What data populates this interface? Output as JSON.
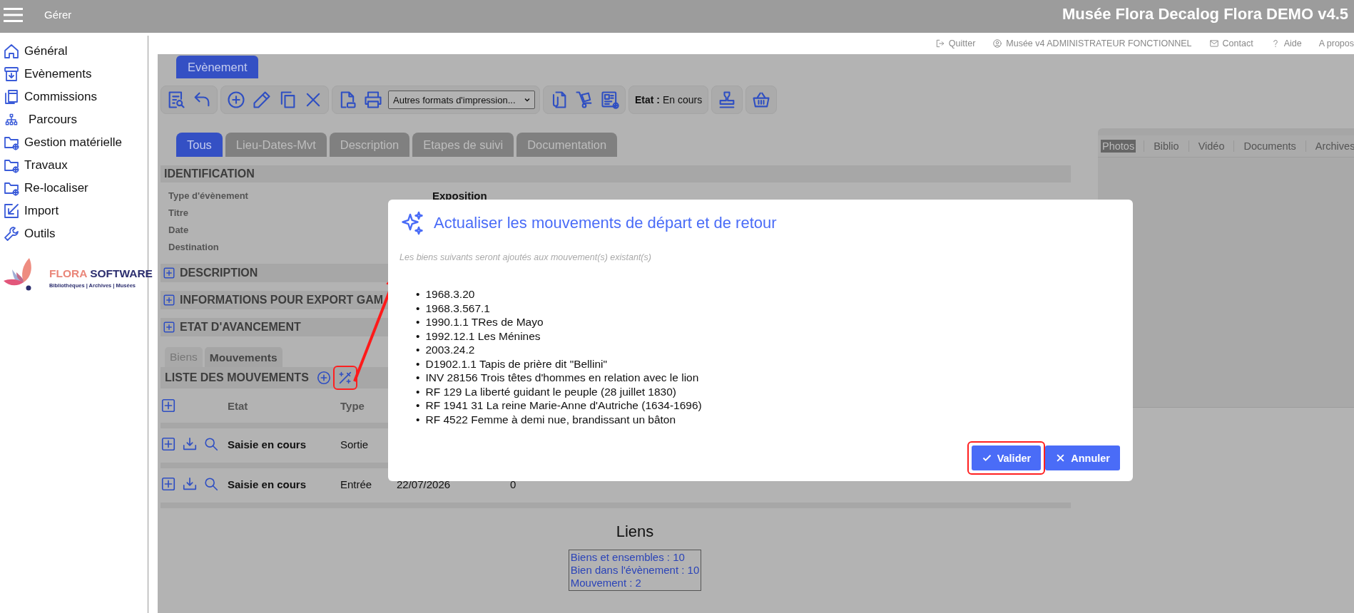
{
  "header": {
    "menu_label": "Gérer",
    "app_title": "Musée Flora Decalog Flora DEMO v4.5"
  },
  "sidebar": {
    "items": [
      {
        "kind": "home",
        "label": "Général"
      },
      {
        "kind": "archive-box",
        "label": "Evènements"
      },
      {
        "kind": "documents",
        "label": "Commissions"
      },
      {
        "kind": "sitemap",
        "label": "Parcours"
      },
      {
        "kind": "folder-globe",
        "label": "Gestion matérielle"
      },
      {
        "kind": "folder-globe",
        "label": "Travaux"
      },
      {
        "kind": "folder-globe",
        "label": "Re-localiser"
      },
      {
        "kind": "import-arrow",
        "label": "Import"
      },
      {
        "kind": "wrench",
        "label": "Outils"
      }
    ],
    "logo": {
      "brand_parts": [
        "FLORA",
        "SOFTWARE"
      ],
      "tagline": "Bibliothèques | Archives | Musées"
    }
  },
  "top_links": [
    {
      "kind": "logout",
      "label": "Quitter"
    },
    {
      "kind": "user",
      "label": "Musée v4 ADMINISTRATEUR FONCTIONNEL"
    },
    {
      "kind": "mail",
      "label": "Contact"
    },
    {
      "kind": "help",
      "label": "Aide"
    },
    {
      "kind": "plain",
      "label": "A propos"
    }
  ],
  "record_tab": "Evènement",
  "toolbar": [
    {
      "kind": "buttons",
      "items": [
        {
          "kind": "list-search"
        },
        {
          "kind": "undo"
        }
      ]
    },
    {
      "kind": "buttons",
      "items": [
        {
          "kind": "plus-circle"
        },
        {
          "kind": "pencil"
        },
        {
          "kind": "copy"
        },
        {
          "kind": "close"
        }
      ]
    },
    {
      "kind": "print",
      "items": [
        {
          "kind": "file-print"
        },
        {
          "kind": "printer"
        }
      ],
      "select": "Autres formats d'impression..."
    },
    {
      "kind": "buttons",
      "items": [
        {
          "kind": "file-clip"
        },
        {
          "kind": "hand-truck"
        },
        {
          "kind": "newspaper"
        }
      ]
    },
    {
      "kind": "status",
      "text": "**Etat :** En cours"
    },
    {
      "kind": "buttons",
      "items": [
        {
          "kind": "stamp"
        }
      ]
    },
    {
      "kind": "buttons",
      "items": [
        {
          "kind": "basket"
        }
      ]
    }
  ],
  "section_tabs": [
    {
      "label": "Tous",
      "selected": true
    },
    {
      "label": "Lieu-Dates-Mvt",
      "selected": false
    },
    {
      "label": "Description",
      "selected": false
    },
    {
      "label": "Etapes de suivi",
      "selected": false
    },
    {
      "label": "Documentation",
      "selected": false
    }
  ],
  "identification": {
    "title": "IDENTIFICATION",
    "fields": [
      {
        "label": "Type d'évènement",
        "value": "Exposition"
      },
      {
        "label": "Titre"
      },
      {
        "label": "Date"
      },
      {
        "label": "Destination"
      }
    ]
  },
  "collapsed_sections": [
    {
      "title": "DESCRIPTION",
      "expanded": false
    },
    {
      "title": "INFORMATIONS POUR EXPORT GAM",
      "expanded": false
    },
    {
      "title": "ETAT D'AVANCEMENT",
      "expanded": false
    }
  ],
  "list_tabs": [
    {
      "label": "Biens",
      "selected": false
    },
    {
      "label": "Mouvements",
      "selected": true
    }
  ],
  "movements": {
    "title": "LISTE DES MOUVEMENTS",
    "wand_highlighted": true,
    "columns": [
      "Etat",
      "Type"
    ],
    "rows": [
      {
        "etat": "Saisie en cours",
        "type": "Sortie"
      },
      {
        "etat": "Saisie en cours",
        "type": "Entrée",
        "column_3": "22/07/2026",
        "column_4": "0"
      }
    ]
  },
  "links": {
    "title": "Liens",
    "items": [
      "Biens et ensembles : 10",
      "Bien dans l'évènement : 10",
      "Mouvement : 2"
    ]
  },
  "media_panel": {
    "tabs": [
      {
        "label": "Photos",
        "selected": true
      },
      {
        "label": "Biblio",
        "selected": false
      },
      {
        "label": "Vidéo",
        "selected": false
      },
      {
        "label": "Documents",
        "selected": false
      },
      {
        "label": "Archives",
        "selected": false
      }
    ]
  },
  "dialog": {
    "bullet": "•",
    "title": "Actualiser les mouvements de départ et de retour",
    "subtitle": "Les biens suivants seront ajoutés aux mouvement(s) existant(s)",
    "items": [
      "1968.3.20",
      "1968.3.567.1",
      "1990.1.1 TRes de Mayo",
      "1992.12.1 Les Ménines",
      "2003.24.2",
      "D1902.1.1 Tapis de prière dit \"Bellini\"",
      "INV 28156 Trois têtes d'hommes en relation avec le lion",
      "RF 129 La liberté guidant le peuple (28 juillet 1830)",
      "RF 1941 31 La reine Marie-Anne d'Autriche (1634-1696)",
      "RF 4522 Femme à demi nue, brandissant un bâton"
    ],
    "buttons": [
      {
        "kind": "confirm",
        "label": "Valider",
        "highlighted": true
      },
      {
        "kind": "cancel",
        "label": "Annuler",
        "highlighted": false
      }
    ]
  }
}
